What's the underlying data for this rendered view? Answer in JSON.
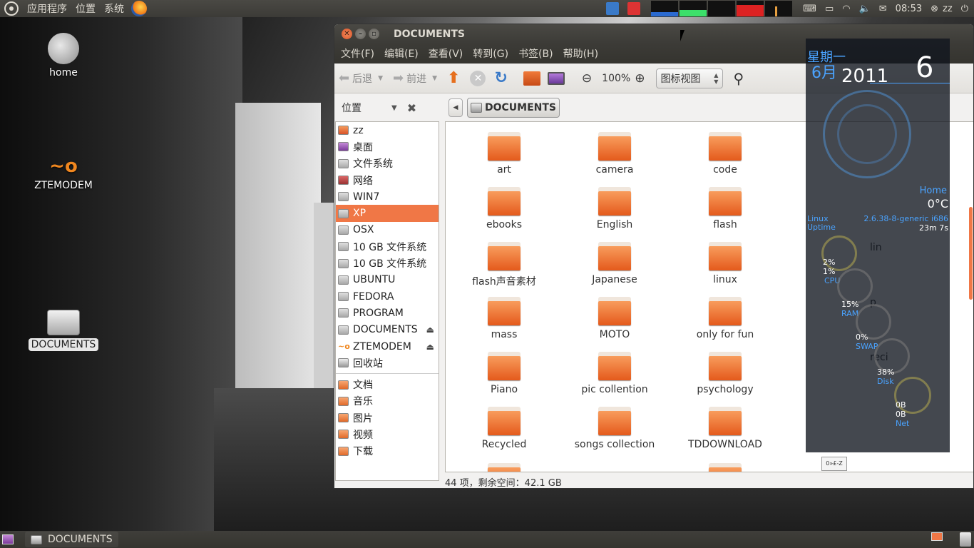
{
  "top_panel": {
    "menus": [
      "应用程序",
      "位置",
      "系统"
    ],
    "clock": "08:53",
    "user": "zz"
  },
  "desktop": {
    "icons": [
      {
        "label": "home",
        "icon": "gnome-foot-icon"
      },
      {
        "label": "ZTEMODEM",
        "icon": "zte-logo-icon"
      },
      {
        "label": "DOCUMENTS",
        "icon": "drive-icon"
      }
    ]
  },
  "window": {
    "title": "DOCUMENTS",
    "menu": [
      "文件(F)",
      "编辑(E)",
      "查看(V)",
      "转到(G)",
      "书签(B)",
      "帮助(H)"
    ],
    "toolbar": {
      "back": "后退",
      "forward": "前进",
      "zoom": "100%",
      "view_mode": "图标视图"
    },
    "sidebar_title": "位置",
    "sidebar_places": [
      {
        "label": "zz",
        "icon": "home"
      },
      {
        "label": "桌面",
        "icon": "desk"
      },
      {
        "label": "文件系统",
        "icon": "drive"
      },
      {
        "label": "网络",
        "icon": "net"
      },
      {
        "label": "WIN7",
        "icon": "drive"
      },
      {
        "label": "XP",
        "icon": "drive",
        "selected": true
      },
      {
        "label": "OSX",
        "icon": "drive"
      },
      {
        "label": "10 GB 文件系统",
        "icon": "drive"
      },
      {
        "label": "10 GB 文件系统",
        "icon": "drive"
      },
      {
        "label": "UBUNTU",
        "icon": "drive"
      },
      {
        "label": "FEDORA",
        "icon": "drive"
      },
      {
        "label": "PROGRAM",
        "icon": "drive"
      },
      {
        "label": "DOCUMENTS",
        "icon": "drive",
        "eject": true
      },
      {
        "label": "ZTEMODEM",
        "icon": "zte",
        "eject": true
      },
      {
        "label": "回收站",
        "icon": "trash"
      }
    ],
    "sidebar_bookmarks": [
      {
        "label": "文档"
      },
      {
        "label": "音乐"
      },
      {
        "label": "图片"
      },
      {
        "label": "视频"
      },
      {
        "label": "下载"
      }
    ],
    "path": "DOCUMENTS",
    "files": [
      [
        "art",
        "camera",
        "code",
        ""
      ],
      [
        "ebooks",
        "English",
        "flash",
        ""
      ],
      [
        "flash声音素材",
        "Japanese",
        "linux",
        "lin"
      ],
      [
        "mass",
        "MOTO",
        "only for fun",
        "p"
      ],
      [
        "Piano",
        "pic collention",
        "psychology",
        "reci"
      ],
      [
        "Recycled",
        "songs collection",
        "TDDOWNLOAD",
        ""
      ]
    ],
    "status": "44 项，剩余空间：42.1 GB"
  },
  "conky": {
    "weekday": "星期一",
    "month": "6月",
    "year": "2011",
    "day": "6",
    "location": "Home",
    "temp": "0°C",
    "os": "Linux",
    "kernel": "2.6.38-8-generic i686",
    "uptime_label": "Uptime",
    "uptime": "23m 7s",
    "cpu1": "2%",
    "cpu2": "1%",
    "cpu_label": "CPU",
    "ram": "15%",
    "ram_label": "RAM",
    "swap": "0%",
    "swap_label": "SWAP",
    "disk": "38%",
    "disk_label": "Disk",
    "net_down": "0B",
    "net_up": "0B",
    "net_label": "Net",
    "note": "0»£-Z"
  },
  "bottom_panel": {
    "task": "DOCUMENTS"
  }
}
